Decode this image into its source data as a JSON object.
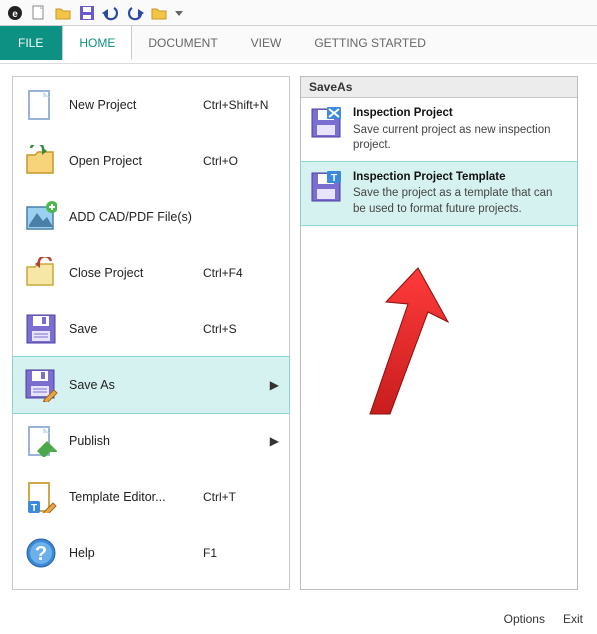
{
  "tabs": {
    "file": "FILE",
    "home": "HOME",
    "document": "DOCUMENT",
    "view": "VIEW",
    "getting_started": "GETTING STARTED"
  },
  "menu": {
    "new_project": {
      "label": "New Project",
      "shortcut": "Ctrl+Shift+N"
    },
    "open_project": {
      "label": "Open Project",
      "shortcut": "Ctrl+O"
    },
    "add_cad": {
      "label": "ADD CAD/PDF File(s)",
      "shortcut": ""
    },
    "close_project": {
      "label": "Close Project",
      "shortcut": "Ctrl+F4"
    },
    "save": {
      "label": "Save",
      "shortcut": "Ctrl+S"
    },
    "save_as": {
      "label": "Save As",
      "shortcut": ""
    },
    "publish": {
      "label": "Publish",
      "shortcut": ""
    },
    "template_editor": {
      "label": "Template Editor...",
      "shortcut": "Ctrl+T"
    },
    "help": {
      "label": "Help",
      "shortcut": "F1"
    }
  },
  "subpanel": {
    "title": "SaveAs",
    "item1": {
      "title": "Inspection Project",
      "desc": "Save current project as new inspection project."
    },
    "item2": {
      "title": "Inspection Project Template",
      "desc": "Save the project as a template that can be used to format future projects."
    }
  },
  "footer": {
    "options": "Options",
    "exit": "Exit"
  }
}
